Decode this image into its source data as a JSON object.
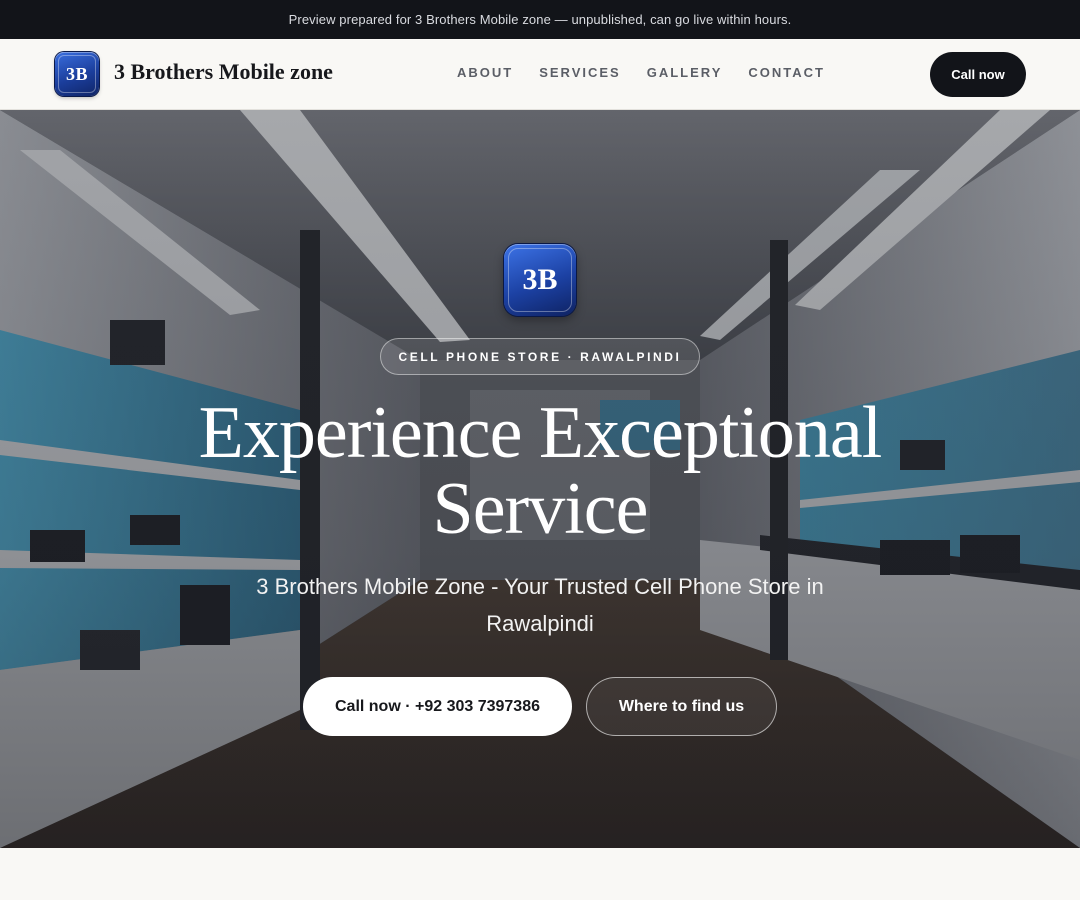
{
  "banner": {
    "text": "Preview prepared for 3 Brothers Mobile zone — unpublished, can go live within hours."
  },
  "header": {
    "logo_text": "3B",
    "brand_name": "3 Brothers Mobile zone",
    "nav": [
      "ABOUT",
      "SERVICES",
      "GALLERY",
      "CONTACT"
    ],
    "cta_label": "Call now"
  },
  "hero": {
    "logo_text": "3B",
    "eyebrow": "CELL PHONE STORE · RAWALPINDI",
    "title": "Experience Exceptional Service",
    "subtitle": "3 Brothers Mobile Zone - Your Trusted Cell Phone Store in Rawalpindi",
    "primary_button": "Call now · +92 303 7397386",
    "secondary_button": "Where to find us"
  },
  "colors": {
    "dark": "#121419",
    "page_bg": "#f9f8f5",
    "logo_blue": "#1b3e9c",
    "accent_cyan": "#2aa7d6"
  }
}
